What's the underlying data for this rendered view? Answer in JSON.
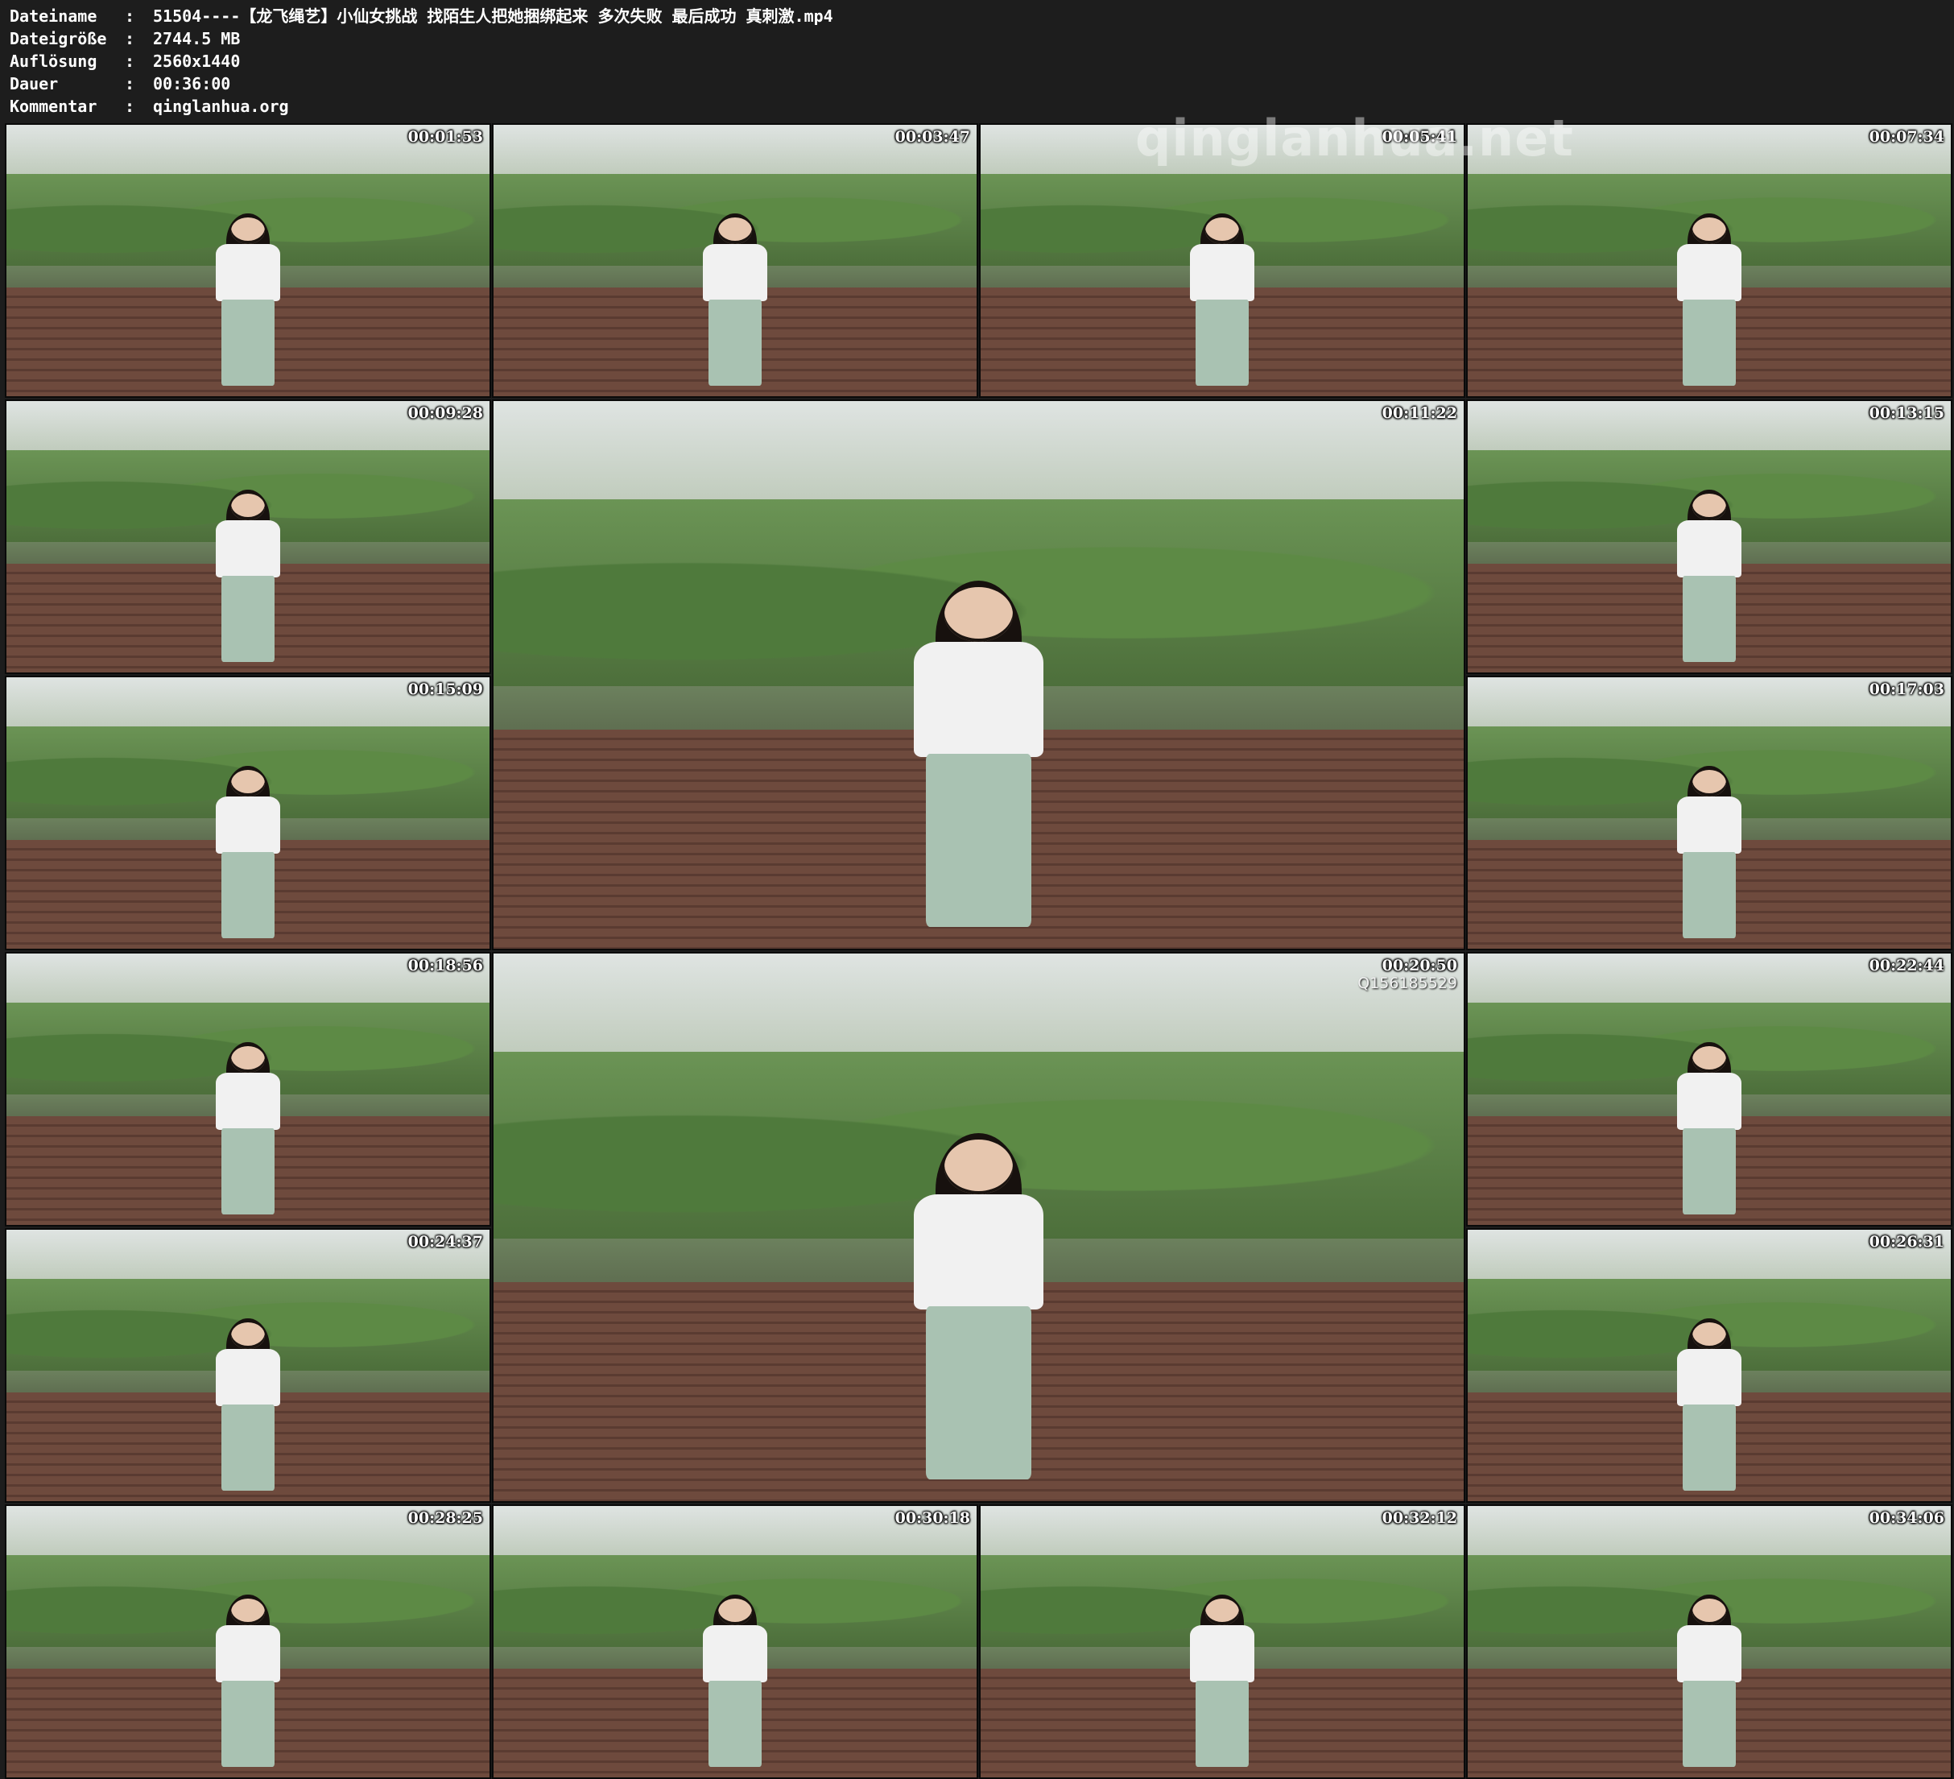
{
  "meta": [
    {
      "key": "Dateiname",
      "value": "51504----【龙飞绳艺】小仙女挑战 找陌生人把她捆绑起来 多次失败 最后成功 真刺激.mp4"
    },
    {
      "key": "Dateigröße",
      "value": "2744.5 MB"
    },
    {
      "key": "Auflösung",
      "value": "2560x1440"
    },
    {
      "key": "Dauer",
      "value": "00:36:00"
    },
    {
      "key": "Kommentar",
      "value": "qinglanhua.org"
    }
  ],
  "separator": ":",
  "watermark": "qinglanhua.net",
  "thumbnails": [
    {
      "ts": "00:01:53"
    },
    {
      "ts": "00:03:47"
    },
    {
      "ts": "00:05:41"
    },
    {
      "ts": "00:07:34"
    },
    {
      "ts": "00:09:28"
    },
    {
      "ts": "00:11:22"
    },
    {
      "ts": "00:13:15"
    },
    {
      "ts": "00:15:09"
    },
    {
      "ts": "00:17:03"
    },
    {
      "ts": "00:18:56"
    },
    {
      "ts": "00:20:50",
      "extra": "Q156185529"
    },
    {
      "ts": "00:22:44"
    },
    {
      "ts": "00:24:37"
    },
    {
      "ts": "00:26:31"
    },
    {
      "ts": "00:28:25"
    },
    {
      "ts": "00:30:18"
    },
    {
      "ts": "00:32:12"
    },
    {
      "ts": "00:34:06"
    }
  ]
}
